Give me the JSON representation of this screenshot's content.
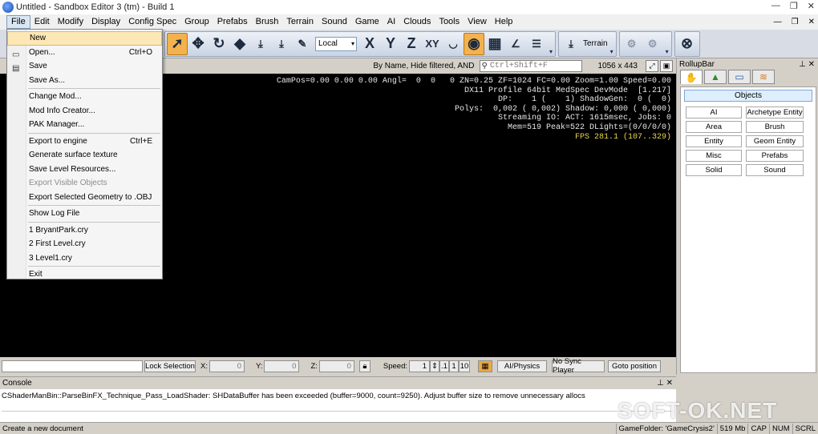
{
  "window": {
    "title": "Untitled - Sandbox Editor 3 (tm) - Build 1"
  },
  "menubar": [
    {
      "label": "File",
      "active": true
    },
    {
      "label": "Edit"
    },
    {
      "label": "Modify"
    },
    {
      "label": "Display"
    },
    {
      "label": "Config Spec"
    },
    {
      "label": "Group"
    },
    {
      "label": "Prefabs"
    },
    {
      "label": "Brush"
    },
    {
      "label": "Terrain"
    },
    {
      "label": "Sound"
    },
    {
      "label": "Game"
    },
    {
      "label": "AI"
    },
    {
      "label": "Clouds"
    },
    {
      "label": "Tools"
    },
    {
      "label": "View"
    },
    {
      "label": "Help"
    }
  ],
  "toolbar": {
    "coord_select": "Local",
    "axis_buttons": [
      "X",
      "Y",
      "Z",
      "XY"
    ],
    "terrain_label": "Terrain"
  },
  "viewport_header": {
    "filter_text": "By Name, Hide filtered, AND",
    "search_placeholder": "Ctrl+Shift+F",
    "resolution": "1056 x 443"
  },
  "viewport_stats": [
    "CamPos=0.00 0.00 0.00 Angl=  0  0   0 ZN=0.25 ZF=1024 FC=0.00 Zoom=1.00 Speed=0.00",
    "DX11 Profile 64bit MedSpec DevMode  [1.217]",
    "DP:    1 (    1) ShadowGen:  0 (  0)",
    "Polys:  0,002 ( 0,002) Shadow: 0,000 ( 0,000)",
    "Streaming IO: ACT: 1615msec, Jobs: 0",
    "Mem=519 Peak=522 DLights=(0/0/0/0)"
  ],
  "viewport_fps": "FPS 281.1 (107..329)",
  "rollup": {
    "title": "RollupBar",
    "objects_label": "Objects",
    "buttons": [
      "AI",
      "Archetype Entity",
      "Area",
      "Brush",
      "Entity",
      "Geom Entity",
      "Misc",
      "Prefabs",
      "Solid",
      "Sound"
    ]
  },
  "controls": {
    "lock_selection": "Lock Selection",
    "x_label": "X:",
    "x_value": "0",
    "y_label": "Y:",
    "y_value": "0",
    "z_label": "Z:",
    "z_value": "0",
    "speed_label": "Speed:",
    "speed_value": "1",
    "speed_options": [
      ".1",
      "1",
      "10"
    ],
    "ai_physics": "AI/Physics",
    "no_sync": "No Sync Player",
    "goto": "Goto position"
  },
  "console": {
    "title": "Console",
    "line": "CShaderManBin::ParseBinFX_Technique_Pass_LoadShader: SHDataBuffer has been exceeded (buffer=9000, count=9250). Adjust buffer size to remove unnecessary allocs"
  },
  "statusbar": {
    "message": "Create a new document",
    "gamefolder": "GameFolder: 'GameCrysis2'",
    "memory": "519 Mb",
    "caps": "CAP",
    "num": "NUM",
    "scrl": "SCRL"
  },
  "file_menu": {
    "items": [
      {
        "label": "New",
        "shortcut": "",
        "highlight": true
      },
      {
        "label": "Open...",
        "shortcut": "Ctrl+O"
      },
      {
        "label": "Save",
        "shortcut": ""
      },
      {
        "label": "Save As...",
        "shortcut": ""
      },
      {
        "sep": true
      },
      {
        "label": "Change Mod...",
        "shortcut": ""
      },
      {
        "label": "Mod Info Creator...",
        "shortcut": ""
      },
      {
        "label": "PAK Manager...",
        "shortcut": ""
      },
      {
        "sep": true
      },
      {
        "label": "Export to engine",
        "shortcut": "Ctrl+E"
      },
      {
        "label": "Generate surface texture",
        "shortcut": ""
      },
      {
        "label": "Save Level Resources...",
        "shortcut": ""
      },
      {
        "label": "Export Visible Objects",
        "shortcut": "",
        "disabled": true
      },
      {
        "label": "Export Selected Geometry to .OBJ",
        "shortcut": ""
      },
      {
        "sep": true
      },
      {
        "label": "Show Log File",
        "shortcut": ""
      },
      {
        "sep": true
      },
      {
        "label": "1 BryantPark.cry",
        "shortcut": ""
      },
      {
        "label": "2 First Level.cry",
        "shortcut": ""
      },
      {
        "label": "3 Level1.cry",
        "shortcut": ""
      },
      {
        "sep": true
      },
      {
        "label": "Exit",
        "shortcut": ""
      }
    ]
  },
  "watermark": "SOFT-OK.NET",
  "colors": {
    "highlight": "#fce7b6",
    "pressed_tool": "#f3b24d",
    "fps": "#e8d84a",
    "viewport": "#000000"
  }
}
